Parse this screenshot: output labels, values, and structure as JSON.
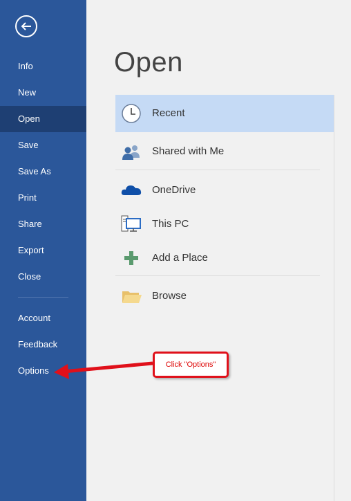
{
  "sidebar": {
    "items": [
      {
        "label": "Info"
      },
      {
        "label": "New"
      },
      {
        "label": "Open"
      },
      {
        "label": "Save"
      },
      {
        "label": "Save As"
      },
      {
        "label": "Print"
      },
      {
        "label": "Share"
      },
      {
        "label": "Export"
      },
      {
        "label": "Close"
      },
      {
        "label": "Account"
      },
      {
        "label": "Feedback"
      },
      {
        "label": "Options"
      }
    ]
  },
  "main": {
    "title": "Open",
    "locations": [
      {
        "label": "Recent",
        "icon": "clock-icon"
      },
      {
        "label": "Shared with Me",
        "icon": "people-icon"
      },
      {
        "label": "OneDrive",
        "icon": "cloud-icon"
      },
      {
        "label": "This PC",
        "icon": "computer-icon"
      },
      {
        "label": "Add a Place",
        "icon": "plus-icon"
      },
      {
        "label": "Browse",
        "icon": "folder-icon"
      }
    ]
  },
  "annotation": {
    "text": "Click \"Options\""
  },
  "colors": {
    "sidebar": "#2b579a",
    "sidebar_active": "#1e3f73",
    "selected": "#c5daf5",
    "callout": "#e0101a"
  }
}
